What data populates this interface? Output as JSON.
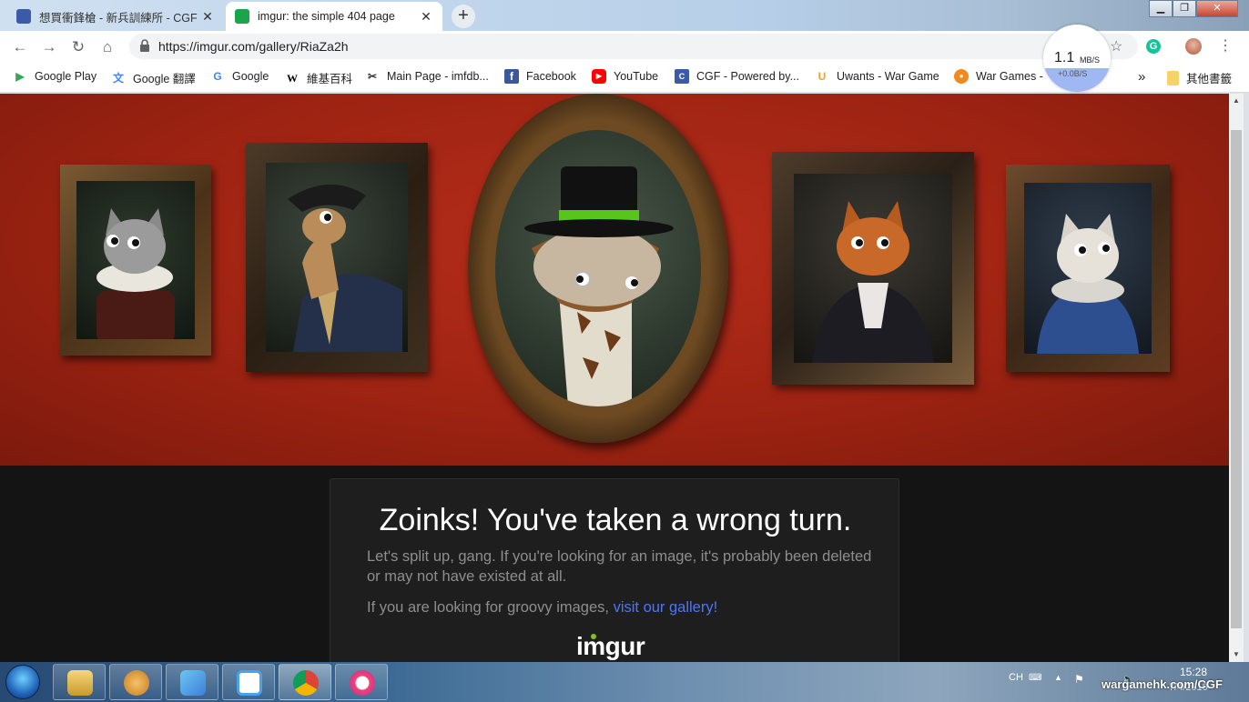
{
  "tabs": [
    {
      "title": "想買衝鋒槍 - 新兵訓練所 - CGF -",
      "favicon_color": "#3b5aa8",
      "active": false
    },
    {
      "title": "imgur: the simple 404 page",
      "favicon_color": "#1aa54b",
      "active": true
    }
  ],
  "toolbar": {
    "url": "https://imgur.com/gallery/RiaZa2h",
    "speed_value": "1.1",
    "speed_unit": "MB/S",
    "speed_sub": "+0.0B/S"
  },
  "bookmarks": [
    {
      "label": "Google Play",
      "icon": "play-icon",
      "color": "#34a853"
    },
    {
      "label": "Google 翻譯",
      "icon": "translate-icon",
      "color": "#4285f4"
    },
    {
      "label": "Google",
      "icon": "google-icon",
      "color": "#4285f4"
    },
    {
      "label": "維基百科",
      "icon": "wikipedia-icon",
      "color": "#000000"
    },
    {
      "label": "Main Page - imfdb...",
      "icon": "imfdb-icon",
      "color": "#333333"
    },
    {
      "label": "Facebook",
      "icon": "facebook-icon",
      "color": "#3b5998"
    },
    {
      "label": "YouTube",
      "icon": "youtube-icon",
      "color": "#ff0000"
    },
    {
      "label": "CGF - Powered by...",
      "icon": "cgf-icon",
      "color": "#3b5aa8"
    },
    {
      "label": "Uwants - War Game",
      "icon": "uwants-icon",
      "color": "#f2a01d"
    },
    {
      "label": "War Games -",
      "icon": "chat-icon",
      "color": "#f08a1c"
    }
  ],
  "bookmarks_more": "»",
  "other_bookmarks": "其他書籤",
  "page": {
    "headline": "Zoinks! You've taken a wrong turn.",
    "subtext": "Let's split up, gang. If you're looking for an image, it's probably been deleted or may not have existed at all.",
    "gallery_prefix": "If you are looking for groovy images, ",
    "gallery_link": "visit our gallery!",
    "logo": "imgur"
  },
  "taskbar": {
    "input_lang": "CH",
    "time": "15:28",
    "date": "7/4/2019",
    "watermark": "wargamehk.com/CGF"
  }
}
